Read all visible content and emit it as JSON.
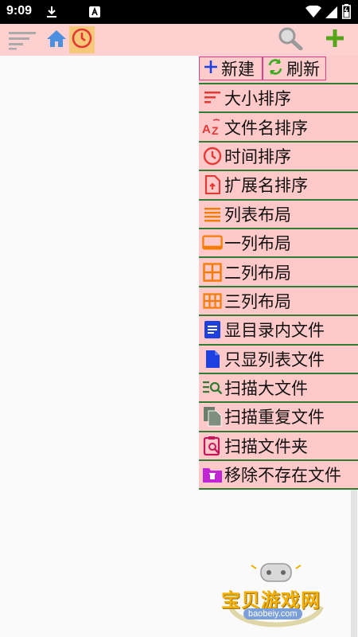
{
  "status_bar": {
    "time": "9:09",
    "icons": [
      "download-icon",
      "a-icon",
      "wifi-icon",
      "signal-icon",
      "battery-icon"
    ]
  },
  "toolbar": {
    "left": [
      "sort-lines-icon",
      "home-icon",
      "clock-icon"
    ],
    "right": [
      "search-icon",
      "add-icon"
    ],
    "accent_add": "#55a51b"
  },
  "menu": {
    "new_label": "新建",
    "refresh_label": "刷新",
    "items": [
      {
        "label": "大小排序",
        "icon": "sort-size-icon",
        "color": "#e53935"
      },
      {
        "label": "文件名排序",
        "icon": "sort-az-icon",
        "color": "#e53935"
      },
      {
        "label": "时间排序",
        "icon": "clock-icon",
        "color": "#e53935"
      },
      {
        "label": "扩展名排序",
        "icon": "file-upload-icon",
        "color": "#e53935"
      },
      {
        "label": "列表布局",
        "icon": "list-icon",
        "color": "#f57c00"
      },
      {
        "label": "一列布局",
        "icon": "tablet-icon",
        "color": "#f57c00"
      },
      {
        "label": "二列布局",
        "icon": "grid-2-icon",
        "color": "#f57c00"
      },
      {
        "label": "三列布局",
        "icon": "grid-3-icon",
        "color": "#f57c00"
      },
      {
        "label": "显目录内文件",
        "icon": "document-icon",
        "color": "#1e40e0"
      },
      {
        "label": "只显列表文件",
        "icon": "file-icon",
        "color": "#1e40e0"
      },
      {
        "label": "扫描大文件",
        "icon": "list-search-icon",
        "color": "#2e7d32"
      },
      {
        "label": "扫描重复文件",
        "icon": "copy-file-icon",
        "color": "#5d7a5d"
      },
      {
        "label": "扫描文件夹",
        "icon": "clipboard-search-icon",
        "color": "#c2185b"
      },
      {
        "label": "移除不存在文件",
        "icon": "folder-delete-icon",
        "color": "#c026d3"
      }
    ]
  },
  "watermark": {
    "text": "宝贝游戏网",
    "url": "baobeiy.com"
  }
}
